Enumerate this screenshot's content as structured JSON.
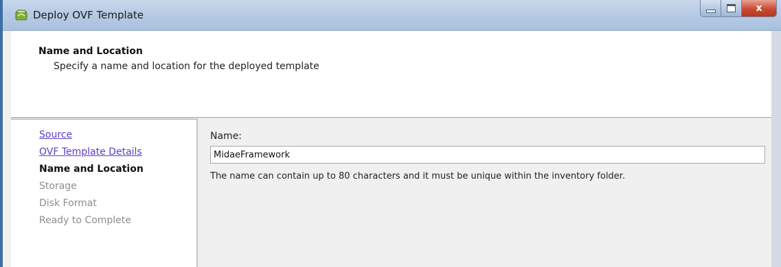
{
  "window": {
    "title": "Deploy OVF Template",
    "app_icon": "ovf-template-icon",
    "controls": [
      "minimize-icon",
      "maximize-icon",
      "close-icon"
    ],
    "close_glyph": "x"
  },
  "header": {
    "title": "Name and Location",
    "subtitle": "Specify a name and location for the deployed template"
  },
  "steps": [
    {
      "label": "Source",
      "state": "link"
    },
    {
      "label": "OVF Template Details",
      "state": "link"
    },
    {
      "label": "Name and Location",
      "state": "current"
    },
    {
      "label": "Storage",
      "state": "disabled"
    },
    {
      "label": "Disk Format",
      "state": "disabled"
    },
    {
      "label": "Ready to Complete",
      "state": "disabled"
    }
  ],
  "form": {
    "name_label": "Name:",
    "name_value": "MidaeFramework",
    "hint": "The name can contain up to 80 characters and it must be unique within the inventory folder."
  },
  "colors": {
    "link": "#5b3cc4",
    "disabled": "#8c8c8c",
    "titlebar": "#b7cbe4",
    "close": "#c84b33"
  }
}
